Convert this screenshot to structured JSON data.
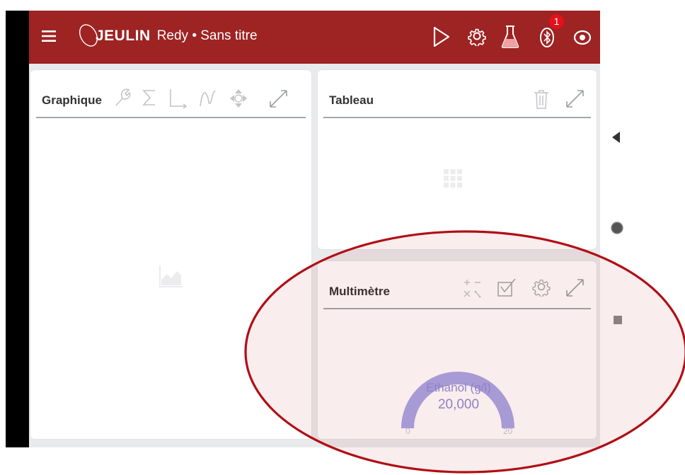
{
  "topbar": {
    "brand": "JEULIN",
    "app_title": "Redy • Sans titre",
    "notification_count": "1",
    "colors": {
      "background": "#9e2323",
      "badge": "#e4111a"
    }
  },
  "panels": {
    "graph": {
      "title": "Graphique"
    },
    "table": {
      "title": "Tableau"
    },
    "multimeter": {
      "title": "Multimètre",
      "gauge": {
        "label": "Ethanol (g/l)",
        "value": "20,000",
        "min": "0",
        "max": "20",
        "fill_fraction": 1.0,
        "color": "#a8a6e6"
      }
    }
  },
  "annotation": {
    "shape": "ellipse",
    "color": "#b10e14"
  }
}
